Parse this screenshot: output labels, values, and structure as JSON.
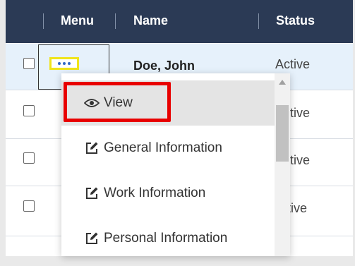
{
  "table": {
    "columns": [
      "Menu",
      "Name",
      "Status"
    ],
    "rows": [
      {
        "name": "Doe, John",
        "status": "Active"
      },
      {
        "name": "",
        "status": "Active"
      },
      {
        "name": "",
        "status": "Active"
      },
      {
        "name": "",
        "status": "Inactive"
      }
    ]
  },
  "menu": {
    "items": [
      {
        "label": "View",
        "icon": "eye-icon"
      },
      {
        "label": "General Information",
        "icon": "edit-icon"
      },
      {
        "label": "Work Information",
        "icon": "edit-icon"
      },
      {
        "label": "Personal Information",
        "icon": "edit-icon"
      }
    ]
  },
  "colors": {
    "header_bg": "#2b3a55",
    "selected_row_bg": "#e6f1fb",
    "highlight_red": "#e80000",
    "menu_button_border": "#f0e41a",
    "dots": "#2f67c7"
  }
}
